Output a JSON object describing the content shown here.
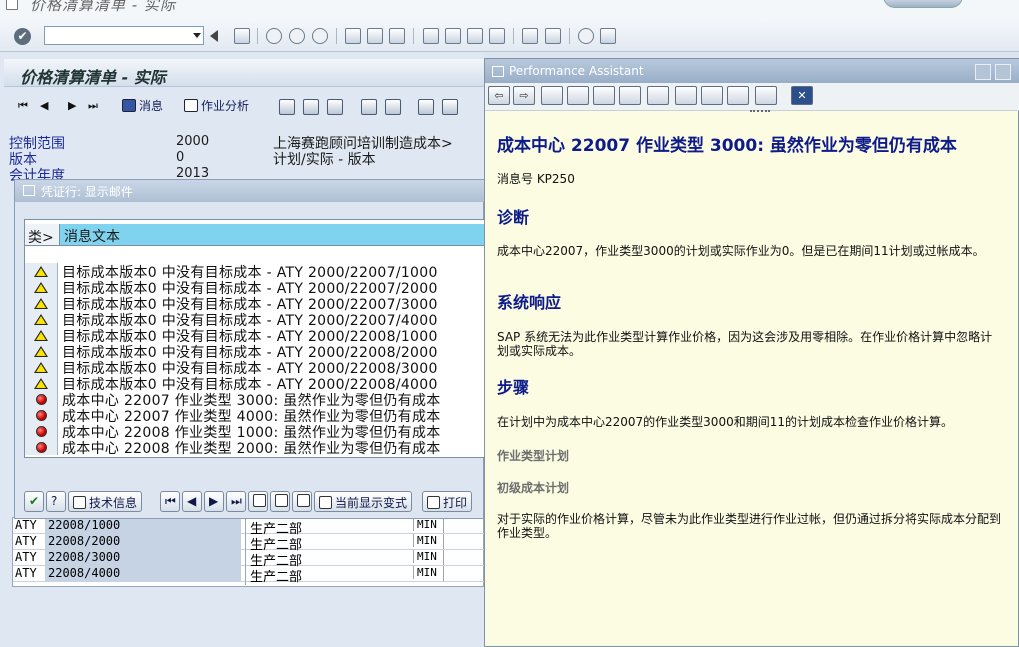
{
  "window": {
    "title": "价格清算清单 - 实际"
  },
  "main": {
    "title": "价格清算清单 - 实际",
    "buttons": {
      "messages": "消息",
      "activity_analysis": "作业分析"
    },
    "fields": [
      {
        "label": "控制范围",
        "value": "2000",
        "desc": "上海赛跑顾问培训制造成本>"
      },
      {
        "label": "版本",
        "value": "0",
        "desc": "计划/实际 - 版本"
      },
      {
        "label": "会计年度",
        "value": "2013",
        "desc": ""
      }
    ],
    "lower_rows": [
      {
        "c1": "ATY",
        "c2": "22008/1000",
        "c3": "生产二部",
        "c4": "MIN"
      },
      {
        "c1": "ATY",
        "c2": "22008/2000",
        "c3": "生产二部",
        "c4": "MIN"
      },
      {
        "c1": "ATY",
        "c2": "22008/3000",
        "c3": "生产二部",
        "c4": "MIN"
      },
      {
        "c1": "ATY",
        "c2": "22008/4000",
        "c3": "生产二部",
        "c4": "MIN"
      }
    ]
  },
  "popup": {
    "title": "凭证行: 显示邮件",
    "header": {
      "type": "类>",
      "text": "消息文本"
    },
    "messages": [
      {
        "type": "warning",
        "text": "目标成本版本0 中没有目标成本 - ATY 2000/22007/1000"
      },
      {
        "type": "warning",
        "text": "目标成本版本0 中没有目标成本 - ATY 2000/22007/2000"
      },
      {
        "type": "warning",
        "text": "目标成本版本0 中没有目标成本 - ATY 2000/22007/3000"
      },
      {
        "type": "warning",
        "text": "目标成本版本0 中没有目标成本 - ATY 2000/22007/4000"
      },
      {
        "type": "warning",
        "text": "目标成本版本0 中没有目标成本 - ATY 2000/22008/1000"
      },
      {
        "type": "warning",
        "text": "目标成本版本0 中没有目标成本 - ATY 2000/22008/2000"
      },
      {
        "type": "warning",
        "text": "目标成本版本0 中没有目标成本 - ATY 2000/22008/3000"
      },
      {
        "type": "warning",
        "text": "目标成本版本0 中没有目标成本 - ATY 2000/22008/4000"
      },
      {
        "type": "error",
        "text": "成本中心 22007 作业类型 3000: 虽然作业为零但仍有成本"
      },
      {
        "type": "error",
        "text": "成本中心 22007 作业类型 4000: 虽然作业为零但仍有成本"
      },
      {
        "type": "error",
        "text": "成本中心 22008 作业类型 1000: 虽然作业为零但仍有成本"
      },
      {
        "type": "error",
        "text": "成本中心 22008 作业类型 2000: 虽然作业为零但仍有成本"
      }
    ],
    "toolbar": {
      "tech_info": "技术信息",
      "current_variant": "当前显示变式",
      "print": "打印"
    }
  },
  "perf": {
    "title": "Performance Assistant",
    "heading": "成本中心 22007 作业类型 3000: 虽然作业为零但仍有成本",
    "msgno": "消息号 KP250",
    "sections": {
      "diag_title": "诊断",
      "diag_text": "成本中心22007，作业类型3000的计划或实际作业为0。但是已在期间11计划或过帐成本。",
      "resp_title": "系统响应",
      "resp_text": "SAP 系统无法为此作业类型计算作业价格，因为这会涉及用零相除。在作业价格计算中忽略计划或实际成本。",
      "steps_title": "步骤",
      "steps_text": "在计划中为成本中心22007的作业类型3000和期间11的计划成本检查作业价格计算。",
      "sub1": "作业类型计划",
      "sub2": "初级成本计划",
      "final_text": "对于实际的作业价格计算，尽管未为此作业类型进行作业过帐，但仍通过拆分将实际成本分配到作业类型。"
    }
  }
}
